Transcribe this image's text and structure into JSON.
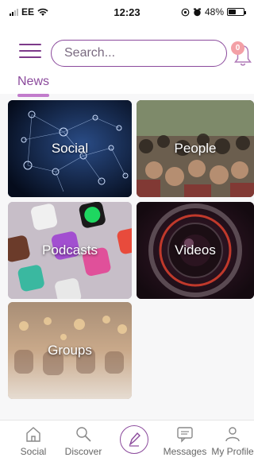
{
  "status_bar": {
    "carrier": "EE",
    "time": "12:23",
    "battery": "48%",
    "battery_level": 0.48
  },
  "header": {
    "search_placeholder": "Search...",
    "notification_count": "0",
    "section_title": "News"
  },
  "tiles": [
    {
      "label": "Social"
    },
    {
      "label": "People"
    },
    {
      "label": "Podcasts"
    },
    {
      "label": "Videos"
    },
    {
      "label": "Groups"
    }
  ],
  "bottom_nav": {
    "items": [
      {
        "label": "Social",
        "icon": "home-icon"
      },
      {
        "label": "Discover",
        "icon": "search-icon"
      },
      {
        "label": "",
        "icon": "compose-pen-icon"
      },
      {
        "label": "Messages",
        "icon": "message-icon"
      },
      {
        "label": "My Profile",
        "icon": "profile-icon"
      }
    ]
  },
  "colors": {
    "accent": "#8b4a9c",
    "badge": "#f3a0a6"
  }
}
